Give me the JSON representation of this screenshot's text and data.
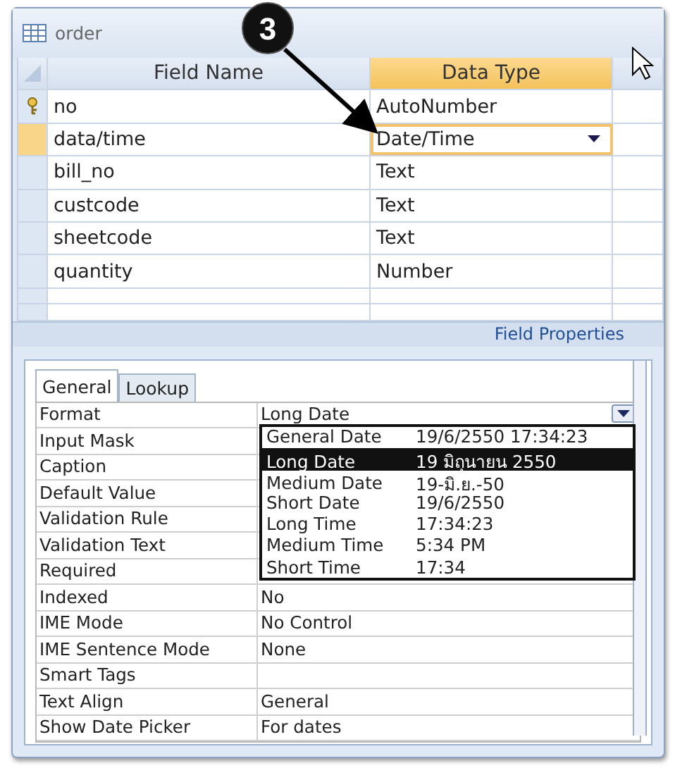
{
  "window": {
    "title": "order"
  },
  "design_grid": {
    "columns": [
      {
        "label": "Field Name",
        "selected": false
      },
      {
        "label": "Data Type",
        "selected": true
      }
    ],
    "rows": [
      {
        "field_name": "no",
        "data_type": "AutoNumber",
        "primary_key": true,
        "selected": false
      },
      {
        "field_name": "data/time",
        "data_type": "Date/Time",
        "primary_key": false,
        "selected": true
      },
      {
        "field_name": "bill_no",
        "data_type": "Text",
        "primary_key": false,
        "selected": false
      },
      {
        "field_name": "custcode",
        "data_type": "Text",
        "primary_key": false,
        "selected": false
      },
      {
        "field_name": "sheetcode",
        "data_type": "Text",
        "primary_key": false,
        "selected": false
      },
      {
        "field_name": "quantity",
        "data_type": "Number",
        "primary_key": false,
        "selected": false
      }
    ]
  },
  "field_properties_label": "Field Properties",
  "property_tabs": [
    {
      "label": "General",
      "selected": true
    },
    {
      "label": "Lookup",
      "selected": false
    }
  ],
  "properties": [
    {
      "name": "Format",
      "value": "Long Date"
    },
    {
      "name": "Input Mask"
    },
    {
      "name": "Caption"
    },
    {
      "name": "Default Value"
    },
    {
      "name": "Validation Rule"
    },
    {
      "name": "Validation Text"
    },
    {
      "name": "Required"
    },
    {
      "name": "Indexed",
      "value": "No"
    },
    {
      "name": "IME Mode",
      "value": "No Control"
    },
    {
      "name": "IME Sentence Mode",
      "value": "None"
    },
    {
      "name": "Smart Tags"
    },
    {
      "name": "Text Align",
      "value": "General"
    },
    {
      "name": "Show Date Picker",
      "value": "For dates"
    }
  ],
  "format_dropdown": {
    "options": [
      {
        "name": "General Date",
        "example": "19/6/2550 17:34:23",
        "selected": false
      },
      {
        "name": "Long Date",
        "example": "19 มิถุนายน 2550",
        "selected": true
      },
      {
        "name": "Medium Date",
        "example": "19-มิ.ย.-50",
        "selected": false
      },
      {
        "name": "Short Date",
        "example": "19/6/2550",
        "selected": false
      },
      {
        "name": "Long Time",
        "example": "17:34:23",
        "selected": false
      },
      {
        "name": "Medium Time",
        "example": "5:34 PM",
        "selected": false
      },
      {
        "name": "Short Time",
        "example": "17:34",
        "selected": false
      }
    ]
  },
  "callout": {
    "number": "3"
  }
}
